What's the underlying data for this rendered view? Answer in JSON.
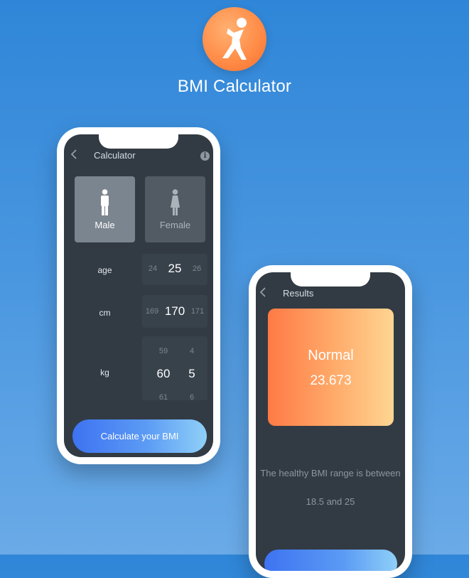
{
  "app": {
    "title": "BMI Calculator",
    "icon": "running-person-icon",
    "icon_color": "#ff8a45"
  },
  "calculator": {
    "header_title": "Calculator",
    "gender": {
      "male_label": "Male",
      "female_label": "Female",
      "selected": "Male"
    },
    "age": {
      "label": "age",
      "prev": "24",
      "value": "25",
      "next": "26"
    },
    "height": {
      "label": "cm",
      "prev": "169",
      "value": "170",
      "next": "171"
    },
    "weight": {
      "label": "kg",
      "int_prev": "59",
      "int_value": "60",
      "int_next": "61",
      "dec_prev": "4",
      "dec_value": "5",
      "dec_next": "6"
    },
    "calculate_label": "Calculate your BMI"
  },
  "results": {
    "header_title": "Results",
    "status": "Normal",
    "bmi": "23.673",
    "range_line1": "The healthy BMI range is between",
    "range_line2": "18.5 and 25"
  },
  "colors": {
    "background": "#3a8ee0",
    "screen": "#323b44",
    "accent_orange": "#ff7a45",
    "accent_blue": "#3d73f2"
  }
}
